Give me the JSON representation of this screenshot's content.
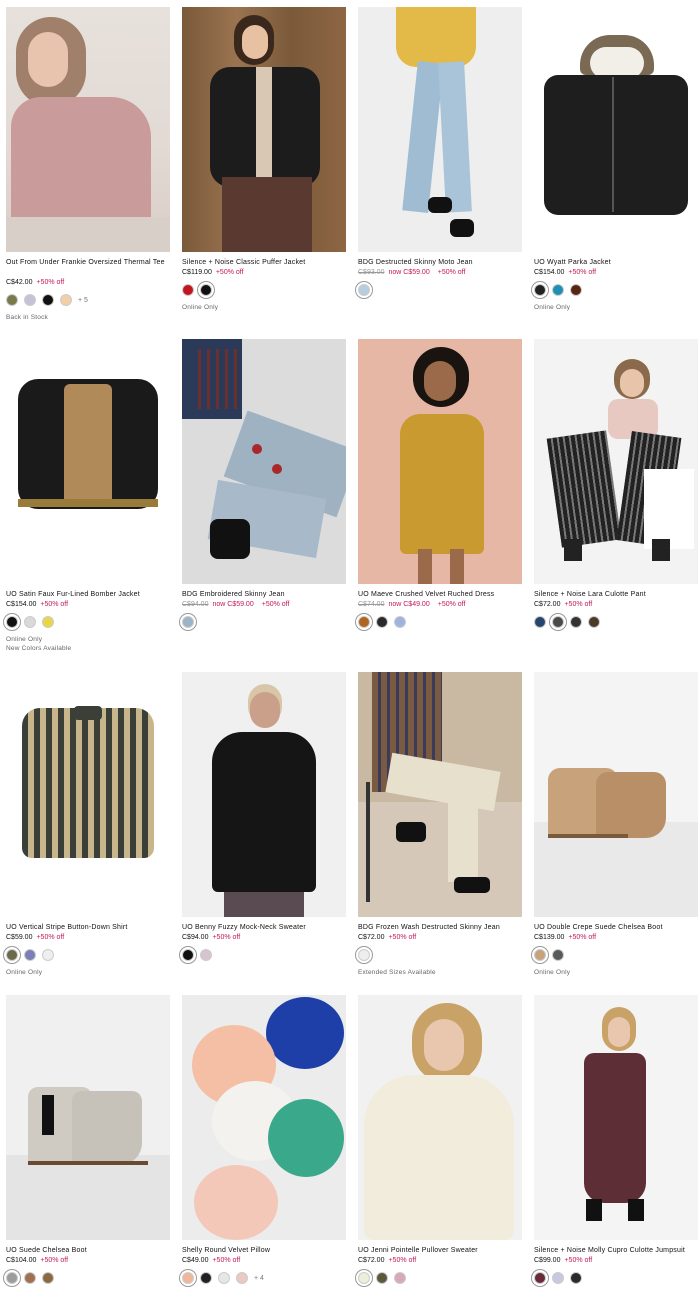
{
  "products": [
    {
      "title": "Out From Under Frankie Oversized Thermal Tee",
      "price": "C$42.00",
      "off": "+50% off",
      "swatches": [
        "#7a7a4a",
        "#c5c2d8",
        "#111111",
        "#f1d0a8"
      ],
      "more": "+ 5",
      "note": "Back in Stock"
    },
    {
      "title": "Silence + Noise Classic Puffer Jacket",
      "price": "C$119.00",
      "off": "+50% off",
      "swatches": [
        "#c0161f",
        "#111111"
      ],
      "note": "Online Only"
    },
    {
      "title": "BDG Destructed Skinny Moto Jean",
      "old": "C$93.00",
      "now": "now C$59.00",
      "off": "+50% off",
      "swatches": [
        "#b7cde0"
      ]
    },
    {
      "title": "UO Wyatt Parka Jacket",
      "price": "C$154.00",
      "off": "+50% off",
      "swatches": [
        "#222222",
        "#1f8fb5",
        "#5a2412"
      ],
      "note": "Online Only"
    },
    {
      "title": "UO Satin Faux Fur-Lined Bomber Jacket",
      "price": "C$154.00",
      "off": "+50% off",
      "swatches": [
        "#111111",
        "#d9d9d9",
        "#e8d64a"
      ],
      "note": "Online Only",
      "note2": "New Colors Available"
    },
    {
      "title": "BDG Embroidered Skinny Jean",
      "old": "C$94.00",
      "now": "now C$59.00",
      "off": "+50% off",
      "swatches": [
        "#9bb4c8"
      ]
    },
    {
      "title": "UO Maeve Crushed Velvet Ruched Dress",
      "old": "C$74.00",
      "now": "now C$49.00",
      "off": "+50% off",
      "swatches": [
        "#b0641e",
        "#2a2a2a",
        "#9fb3dd"
      ]
    },
    {
      "title": "Silence + Noise Lara Culotte Pant",
      "price": "C$72.00",
      "off": "+50% off",
      "swatches": [
        "#27466d",
        "#4a4a4a",
        "#333333",
        "#4a3a28"
      ]
    },
    {
      "title": "UO Vertical Stripe Button-Down Shirt",
      "price": "C$59.00",
      "off": "+50% off",
      "swatches": [
        "#6b6b4b",
        "#7a7fb5",
        "#eeeeee"
      ],
      "note": "Online Only"
    },
    {
      "title": "UO Benny Fuzzy Mock-Neck Sweater",
      "price": "C$94.00",
      "off": "+50% off",
      "swatches": [
        "#111111",
        "#d6c5cf"
      ]
    },
    {
      "title": "BDG Frozen Wash Destructed Skinny Jean",
      "price": "C$72.00",
      "off": "+50% off",
      "swatches": [
        "#eeeeee"
      ],
      "note": "Extended Sizes Available"
    },
    {
      "title": "UO Double Crepe Suede Chelsea Boot",
      "price": "C$139.00",
      "off": "+50% off",
      "swatches": [
        "#c8a27a",
        "#5a5a5a"
      ],
      "note": "Online Only"
    },
    {
      "title": "UO Suede Chelsea Boot",
      "price": "C$104.00",
      "off": "+50% off",
      "swatches": [
        "#9c9c9c",
        "#a07050",
        "#8a6a40"
      ]
    },
    {
      "title": "Shelly Round Velvet Pillow",
      "price": "C$49.00",
      "off": "+50% off",
      "swatches": [
        "#f1b79a",
        "#222222",
        "#e6e6e6",
        "#e9c9c0"
      ],
      "more": "+ 4"
    },
    {
      "title": "UO Jenni Pointelle Pullover Sweater",
      "price": "C$72.00",
      "off": "+50% off",
      "swatches": [
        "#eeeedd",
        "#5a5a3a",
        "#d8a8b8"
      ]
    },
    {
      "title": "Silence + Noise Molly Cupro Culotte Jumpsuit",
      "price": "C$99.00",
      "off": "+50% off",
      "swatches": [
        "#6a2a3a",
        "#c8c8e0",
        "#2a2a2a"
      ]
    }
  ]
}
